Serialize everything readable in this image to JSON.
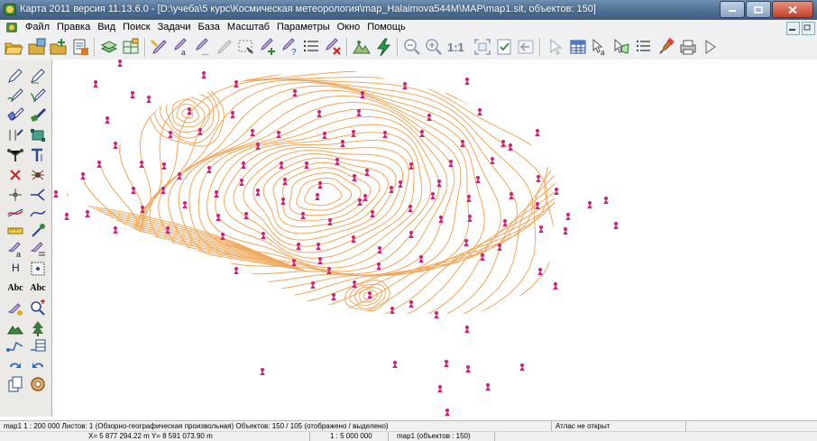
{
  "window": {
    "title": "Карта 2011 версия 11.13.6.0 - [D:\\учеба\\5 курс\\Космическая метеорология\\map_Halaimova544M\\MAP\\map1.sit, объектов: 150]"
  },
  "menu": {
    "items": [
      "Файл",
      "Правка",
      "Вид",
      "Поиск",
      "Задачи",
      "База",
      "Масштаб",
      "Параметры",
      "Окно",
      "Помощь"
    ]
  },
  "toolbar": {
    "scale_1to1_label": "1:1"
  },
  "left_panel": {
    "text_tool_1": "Abc",
    "text_tool_2": "Abc",
    "height_tool": "H"
  },
  "status": {
    "info": "map1  1 : 200 000  Листов: 1   (Обзорно-географическая произвольная)  Объектов: 150 / 105 (отображено / выделено)",
    "atlas": "Атлас не открыт",
    "coords": "X= 5 877 294.22 m    Y= 8 591 073.90 m",
    "scale": "1 : 5 000 000",
    "map_objects": "map1   (объектов : 150)"
  },
  "colors": {
    "contour": "#f0a75a",
    "station_marker": "#d0207a"
  },
  "map_symbols": {
    "station_icon": "weather-station-icon",
    "isoline": "isoline"
  }
}
